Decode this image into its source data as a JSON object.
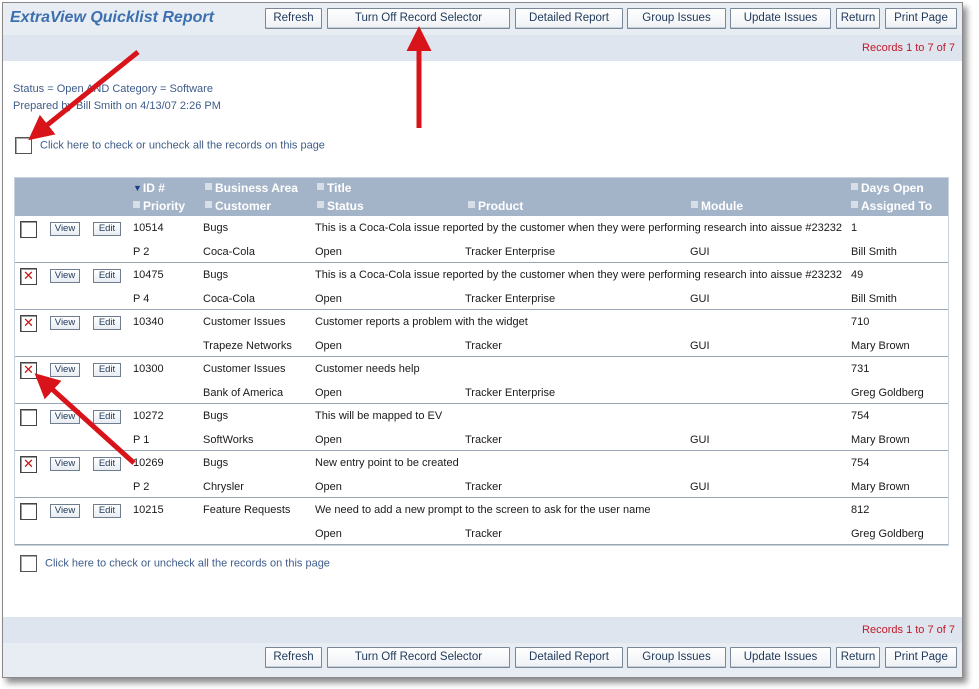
{
  "app": {
    "title": "ExtraView Quicklist Report"
  },
  "toolbar": {
    "refresh": "Refresh",
    "record_selector": "Turn Off Record Selector",
    "detailed_report": "Detailed Report",
    "group_issues": "Group Issues",
    "update_issues": "Update Issues",
    "return": "Return",
    "print_page": "Print Page"
  },
  "records_text": "Records 1 to 7 of 7",
  "filter": {
    "line1": "Status = Open AND Category = Software",
    "line2": "Prepared by Bill Smith on 4/13/07 2:26 PM"
  },
  "check_all_label": "Click here to check or uncheck all the records on this page",
  "columns": {
    "id": "ID #",
    "business_area": "Business Area",
    "title": "Title",
    "days_open": "Days Open",
    "priority": "Priority",
    "customer": "Customer",
    "status": "Status",
    "product": "Product",
    "module": "Module",
    "assigned_to": "Assigned To"
  },
  "row_buttons": {
    "view": "View",
    "edit": "Edit"
  },
  "rows": [
    {
      "checked": "",
      "id": "10514",
      "area": "Bugs",
      "title": "This is a Coca-Cola issue reported by the customer when they were performing research into aissue #23232",
      "days": "1",
      "priority": "P 2",
      "customer": "Coca-Cola",
      "status": "Open",
      "product": "Tracker Enterprise",
      "module": "GUI",
      "assigned": "Bill Smith"
    },
    {
      "checked": "✕",
      "id": "10475",
      "area": "Bugs",
      "title": "This is a Coca-Cola issue reported by the customer when they were performing research into aissue #23232",
      "days": "49",
      "priority": "P 4",
      "customer": "Coca-Cola",
      "status": "Open",
      "product": "Tracker Enterprise",
      "module": "GUI",
      "assigned": "Bill Smith"
    },
    {
      "checked": "✕",
      "id": "10340",
      "area": "Customer Issues",
      "title": "Customer reports a problem with the widget",
      "days": "710",
      "priority": "",
      "customer": "Trapeze Networks",
      "status": "Open",
      "product": "Tracker",
      "module": "GUI",
      "assigned": "Mary Brown"
    },
    {
      "checked": "✕",
      "id": "10300",
      "area": "Customer Issues",
      "title": "Customer needs help",
      "days": "731",
      "priority": "",
      "customer": "Bank of America",
      "status": "Open",
      "product": "Tracker Enterprise",
      "module": "",
      "assigned": "Greg Goldberg"
    },
    {
      "checked": "",
      "id": "10272",
      "area": "Bugs",
      "title": "This will be mapped to EV",
      "days": "754",
      "priority": "P 1",
      "customer": "SoftWorks",
      "status": "Open",
      "product": "Tracker",
      "module": "GUI",
      "assigned": "Mary Brown"
    },
    {
      "checked": "✕",
      "id": "10269",
      "area": "Bugs",
      "title": "New entry point to be created",
      "days": "754",
      "priority": "P 2",
      "customer": "Chrysler",
      "status": "Open",
      "product": "Tracker",
      "module": "GUI",
      "assigned": "Mary Brown"
    },
    {
      "checked": "",
      "id": "10215",
      "area": "Feature Requests",
      "title": "We need to add a new prompt to the screen to ask for the user name",
      "days": "812",
      "priority": "",
      "customer": "",
      "status": "Open",
      "product": "Tracker",
      "module": "",
      "assigned": "Greg Goldberg"
    }
  ],
  "colors": {
    "accent": "#3c6fb0",
    "records_red": "#c0192b",
    "header_bg": "#a4b4c8",
    "annotation_arrow": "#d8141a"
  }
}
